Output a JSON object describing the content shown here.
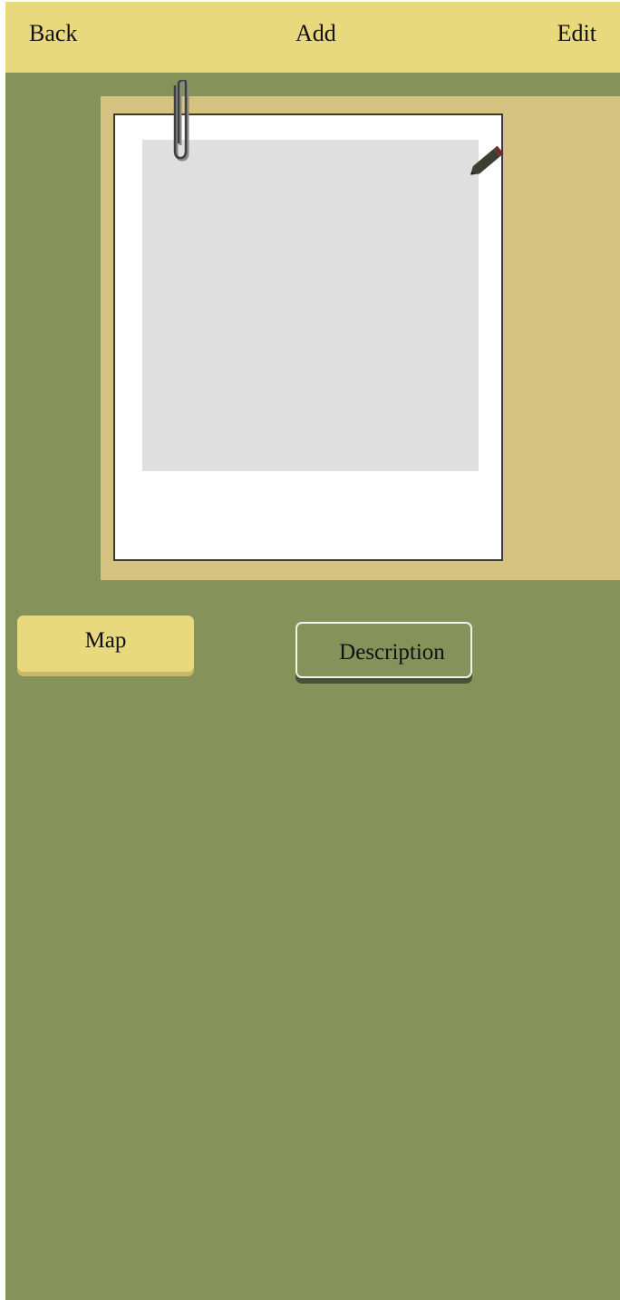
{
  "navbar": {
    "back_label": "Back",
    "title_label": "Add",
    "edit_label": "Edit"
  },
  "tabs": {
    "map_label": "Map",
    "description_label": "Description"
  },
  "icons": {
    "clip": "paperclip-icon",
    "edit_photo": "pencil-icon"
  },
  "colors": {
    "navbar": "#e8d87e",
    "background": "#85935b",
    "board": "#d6c382",
    "photo_placeholder": "#dfdfdf"
  }
}
